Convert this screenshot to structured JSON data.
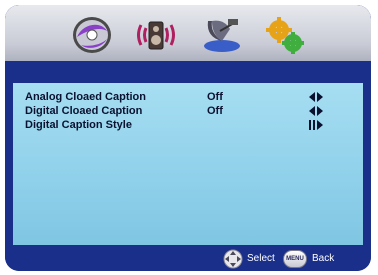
{
  "menu_tabs": [
    {
      "icon": "disc-icon"
    },
    {
      "icon": "speaker-icon"
    },
    {
      "icon": "satellite-dish-icon"
    },
    {
      "icon": "gears-settings-icon"
    }
  ],
  "settings": [
    {
      "label": "Analog Cloaed Caption",
      "value": "Off",
      "control": "left-right-arrows"
    },
    {
      "label": "Digital Cloaed Caption",
      "value": "Off",
      "control": "left-right-arrows"
    },
    {
      "label": "Digital Caption Style",
      "value": "",
      "control": "enter-arrow"
    }
  ],
  "footer": {
    "select_label": "Select",
    "menu_button_label": "MENU",
    "back_label": "Back"
  },
  "colors": {
    "osd_blue": "#1a2f8a",
    "panel_cyan": "#8fd0ea",
    "text_dark": "#0b1230"
  }
}
